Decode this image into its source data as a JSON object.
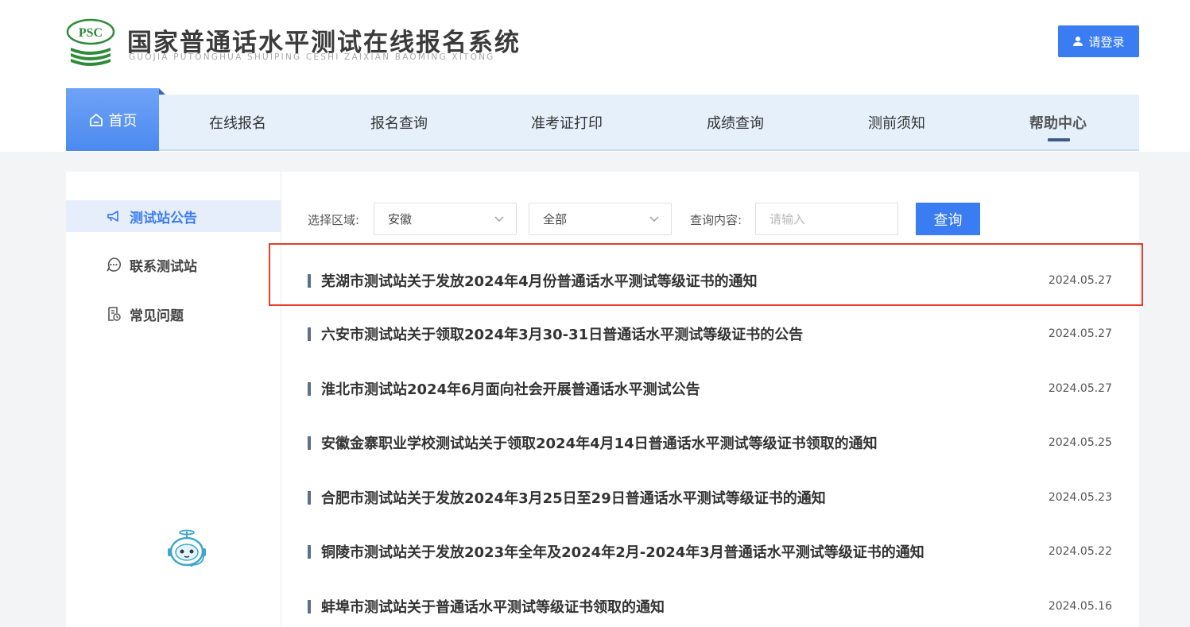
{
  "header": {
    "logo_text": "PSC",
    "title": "国家普通话水平测试在线报名系统",
    "pinyin": "GUOJIA PUTONGHUA SHUIPING CESHI ZAIXIAN BAOMING XITONG",
    "login_label": "请登录"
  },
  "nav": {
    "home": "首页",
    "items": [
      "在线报名",
      "报名查询",
      "准考证打印",
      "成绩查询",
      "测前须知",
      "帮助中心"
    ],
    "active": "帮助中心"
  },
  "sidebar": {
    "items": [
      {
        "label": "测试站公告",
        "icon": "megaphone-icon",
        "active": true
      },
      {
        "label": "联系测试站",
        "icon": "chat-bubble-icon",
        "active": false
      },
      {
        "label": "常见问题",
        "icon": "document-clock-icon",
        "active": false
      }
    ]
  },
  "filters": {
    "region_label": "选择区域:",
    "region_value": "安徽",
    "scope_value": "全部",
    "query_label": "查询内容:",
    "query_placeholder": "请输入",
    "query_button": "查询"
  },
  "news": [
    {
      "title": "芜湖市测试站关于发放2024年4月份普通话水平测试等级证书的通知",
      "date": "2024.05.27",
      "highlighted": true
    },
    {
      "title": "六安市测试站关于领取2024年3月30-31日普通话水平测试等级证书的公告",
      "date": "2024.05.27"
    },
    {
      "title": "淮北市测试站2024年6月面向社会开展普通话水平测试公告",
      "date": "2024.05.27"
    },
    {
      "title": "安徽金寨职业学校测试站关于领取2024年4月14日普通话水平测试等级证书领取的通知",
      "date": "2024.05.25"
    },
    {
      "title": "合肥市测试站关于发放2024年3月25日至29日普通话水平测试等级证书的通知",
      "date": "2024.05.23"
    },
    {
      "title": "铜陵市测试站关于发放2023年全年及2024年2月-2024年3月普通话水平测试等级证书的通知",
      "date": "2024.05.22"
    },
    {
      "title": "蚌埠市测试站关于普通话水平测试等级证书领取的通知",
      "date": "2024.05.16"
    }
  ],
  "colors": {
    "accent": "#3a7cf2",
    "nav_bg": "#e6f0fb",
    "highlight_border": "#e63c2b",
    "logo_green": "#2e8b3a"
  }
}
